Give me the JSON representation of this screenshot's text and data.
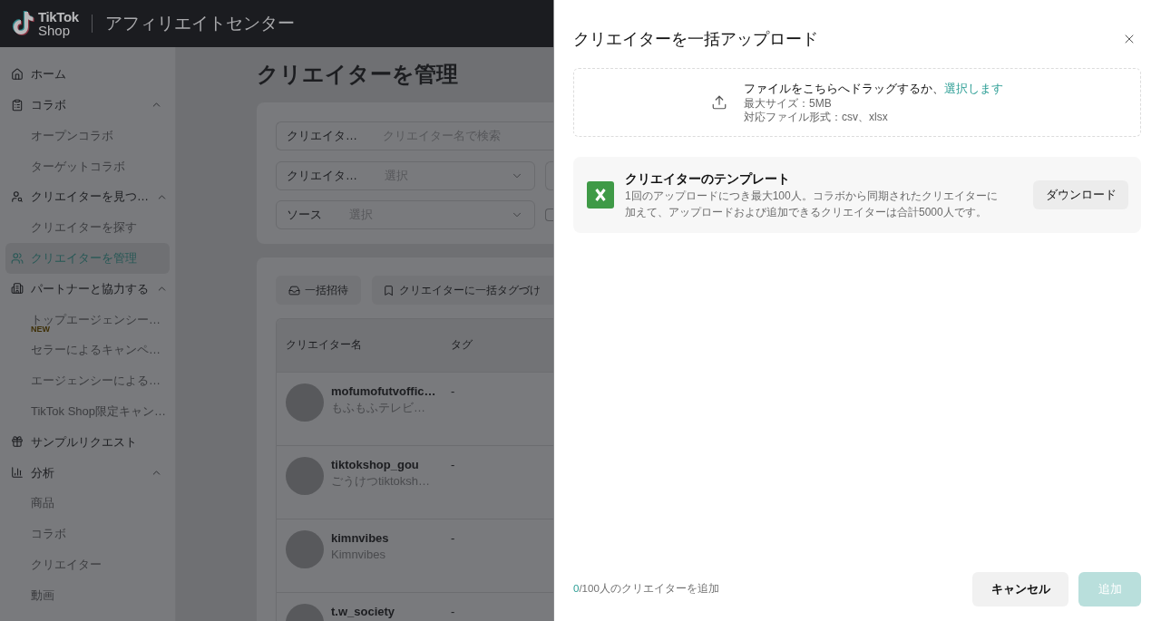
{
  "header": {
    "logo": {
      "line_1": "TikTok",
      "line_2": "Shop"
    },
    "title": "アフィリエイトセンター"
  },
  "sidebar": {
    "items": [
      {
        "label": "ホーム",
        "selected": false
      },
      {
        "label": "コラボ",
        "selected": false,
        "expanded": true,
        "children": [
          {
            "label": "オープンコラボ",
            "selected": false
          },
          {
            "label": "ターゲットコラボ",
            "selected": false
          }
        ]
      },
      {
        "label": "クリエイターを見つ…",
        "selected": false,
        "expanded": true,
        "children": [
          {
            "label": "クリエイターを探す",
            "selected": false
          }
        ]
      },
      {
        "label": "クリエイターを管理",
        "selected": true
      },
      {
        "label": "パートナーと協力する",
        "selected": false,
        "expanded": true,
        "children": [
          {
            "label": "トップエージェンシー…",
            "selected": false,
            "badge": "NEW"
          },
          {
            "label": "セラーによるキャンペ…",
            "selected": false
          },
          {
            "label": "エージェンシーによる…",
            "selected": false
          },
          {
            "label": "TikTok Shop限定キャン…",
            "selected": false
          }
        ]
      },
      {
        "label": "サンプルリクエスト",
        "selected": false
      },
      {
        "label": "分析",
        "selected": false,
        "expanded": true,
        "children": [
          {
            "label": "商品",
            "selected": false
          },
          {
            "label": "コラボ",
            "selected": false
          },
          {
            "label": "クリエイター",
            "selected": false
          },
          {
            "label": "動画",
            "selected": false
          }
        ]
      }
    ]
  },
  "main": {
    "title": "クリエイターを管理",
    "filters": {
      "search": {
        "label": "クリエイタ…",
        "placeholder": "クリエイター名で検索"
      },
      "rows": [
        {
          "label": "クリエイタ…",
          "placeholder": "選択",
          "side": {
            "kind": "field"
          }
        },
        {
          "label": "ソース",
          "placeholder": "選択",
          "side": {
            "kind": "checkbox",
            "checked": false
          }
        }
      ]
    },
    "actions": [
      {
        "label": "一括招待"
      },
      {
        "label": "クリエイターに一括タグづけ"
      }
    ],
    "table": {
      "columns": [
        "クリエイター名",
        "タグ"
      ],
      "rows": [
        {
          "name": "mofumofutvoffic…",
          "display_name": "もふもふテレビ…",
          "tag": "-"
        },
        {
          "name": "tiktokshop_gou",
          "display_name": "ごうけつtiktoksh…",
          "tag": "-"
        },
        {
          "name": "kimnvibes",
          "display_name": "Kimnvibes",
          "tag": "-"
        },
        {
          "name": "t.w_society",
          "tag": "-"
        }
      ]
    }
  },
  "drawer": {
    "title": "クリエイターを一括アップロード",
    "upload": {
      "prompt": "ファイルをこちらへドラッグするか、",
      "link": "選択します",
      "max_size": "最大サイズ：5MB",
      "formats": "対応ファイル形式：csv、xlsx"
    },
    "template": {
      "title": "クリエイターのテンプレート",
      "description": "1回のアップロードにつき最大100人。コラボから同期されたクリエイターに加えて、アップロードおよび追加できるクリエイターは合計5000人です。",
      "button": "ダウンロード"
    },
    "footer": {
      "count": "0",
      "limit_text": "/100人のクリエイターを追加",
      "buttons": [
        {
          "label": "キャンセル",
          "kind": "secondary",
          "disabled": false
        },
        {
          "label": "追加",
          "kind": "primary",
          "disabled": true
        }
      ]
    }
  }
}
